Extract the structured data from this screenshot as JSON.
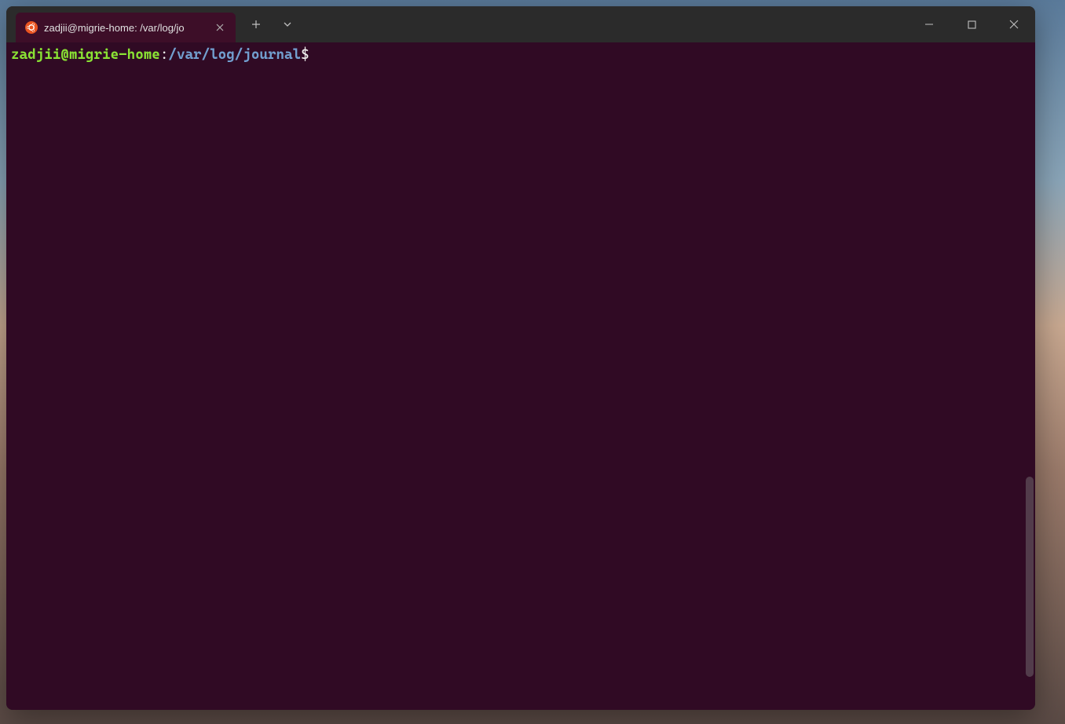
{
  "tab": {
    "title": "zadjii@migrie-home: /var/log/jo",
    "icon": "ubuntu-icon"
  },
  "prompt": {
    "user_host": "zadjii@migrie-home",
    "separator": ":",
    "path": "/var/log/journal",
    "symbol": "$"
  },
  "colors": {
    "terminal_bg": "#300a24",
    "prompt_user": "#8ae234",
    "prompt_path": "#729fcf",
    "titlebar_bg": "#2b2b2b"
  }
}
